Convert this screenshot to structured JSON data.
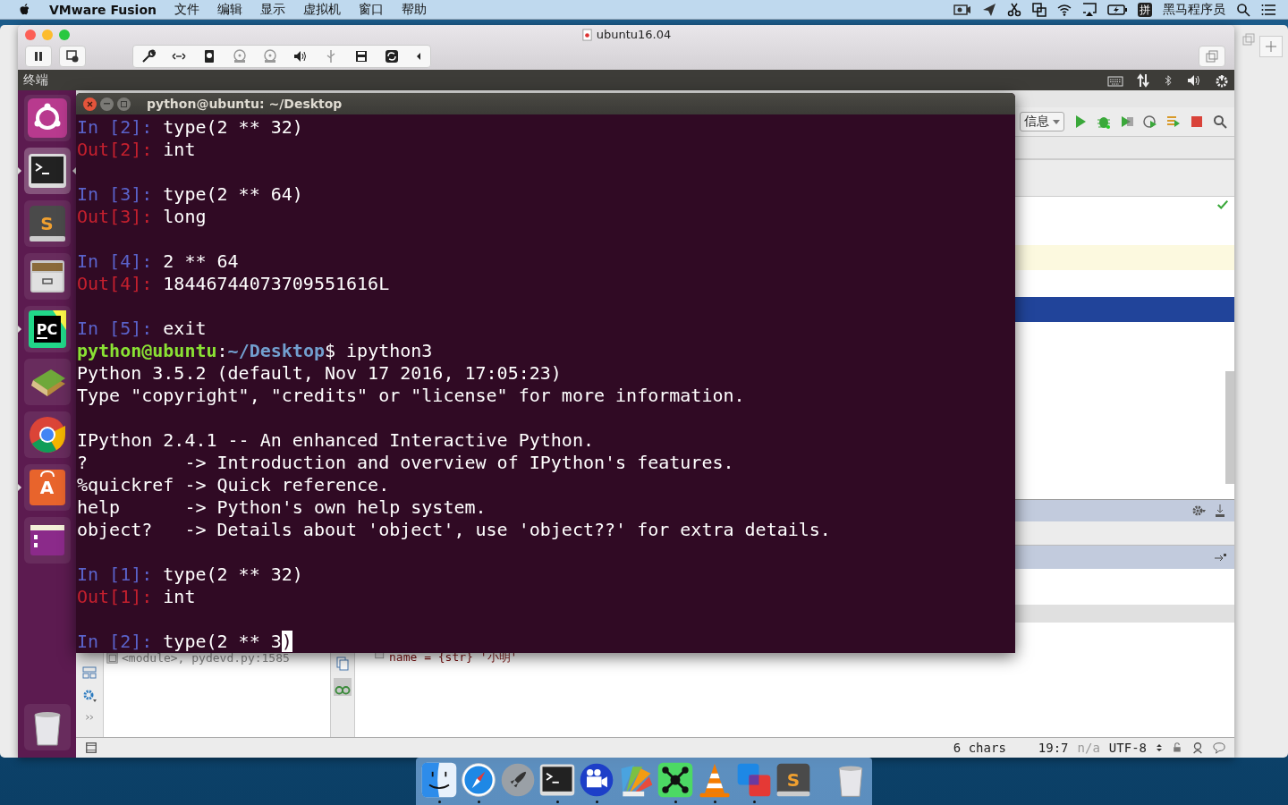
{
  "menubar": {
    "app_name": "VMware Fusion",
    "menus": [
      "文件",
      "编辑",
      "显示",
      "虚拟机",
      "窗口",
      "帮助"
    ],
    "input_method": "拼",
    "user_name": "黑马程序员"
  },
  "vm_window": {
    "title": "ubuntu16.04"
  },
  "ubuntu_panel": {
    "title": "终端"
  },
  "launcher": [
    {
      "kind": "ubuntu",
      "running": false,
      "focused": false
    },
    {
      "kind": "terminal",
      "running": true,
      "focused": true
    },
    {
      "kind": "sublime",
      "glyph": "S",
      "running": false,
      "focused": false
    },
    {
      "kind": "files",
      "running": false,
      "focused": false
    },
    {
      "kind": "pycharm",
      "glyph": "PC",
      "running": true,
      "focused": false
    },
    {
      "kind": "books",
      "running": false,
      "focused": false
    },
    {
      "kind": "chrome",
      "running": false,
      "focused": false
    },
    {
      "kind": "store",
      "glyph": "A",
      "running": true,
      "focused": false
    },
    {
      "kind": "window",
      "running": false,
      "focused": false
    },
    {
      "kind": "trash",
      "running": false,
      "focused": false
    }
  ],
  "terminal": {
    "title": "python@ubuntu: ~/Desktop",
    "lines": [
      {
        "kind": "text",
        "segments": [
          {
            "kind": "in",
            "text": "In [2]: "
          },
          {
            "kind": "plain",
            "text": "type(2 ** 32)"
          }
        ]
      },
      {
        "kind": "text",
        "segments": [
          {
            "kind": "out",
            "text": "Out[2]: "
          },
          {
            "kind": "plain",
            "text": "int"
          }
        ]
      },
      {
        "kind": "blank"
      },
      {
        "kind": "text",
        "segments": [
          {
            "kind": "in",
            "text": "In [3]: "
          },
          {
            "kind": "plain",
            "text": "type(2 ** 64)"
          }
        ]
      },
      {
        "kind": "text",
        "segments": [
          {
            "kind": "out",
            "text": "Out[3]: "
          },
          {
            "kind": "plain",
            "text": "long"
          }
        ]
      },
      {
        "kind": "blank"
      },
      {
        "kind": "text",
        "segments": [
          {
            "kind": "in",
            "text": "In [4]: "
          },
          {
            "kind": "plain",
            "text": "2 ** 64"
          }
        ]
      },
      {
        "kind": "text",
        "segments": [
          {
            "kind": "out",
            "text": "Out[4]: "
          },
          {
            "kind": "plain",
            "text": "18446744073709551616L"
          }
        ]
      },
      {
        "kind": "blank"
      },
      {
        "kind": "text",
        "segments": [
          {
            "kind": "in",
            "text": "In [5]: "
          },
          {
            "kind": "plain",
            "text": "exit"
          }
        ]
      },
      {
        "kind": "text",
        "segments": [
          {
            "kind": "user",
            "text": "python@ubuntu"
          },
          {
            "kind": "plain",
            "text": ":"
          },
          {
            "kind": "path",
            "text": "~/Desktop"
          },
          {
            "kind": "plain",
            "text": "$ ipython3"
          }
        ]
      },
      {
        "kind": "text",
        "segments": [
          {
            "kind": "plain",
            "text": "Python 3.5.2 (default, Nov 17 2016, 17:05:23)"
          }
        ]
      },
      {
        "kind": "text",
        "segments": [
          {
            "kind": "plain",
            "text": "Type \"copyright\", \"credits\" or \"license\" for more information."
          }
        ]
      },
      {
        "kind": "blank"
      },
      {
        "kind": "text",
        "segments": [
          {
            "kind": "plain",
            "text": "IPython 2.4.1 -- An enhanced Interactive Python."
          }
        ]
      },
      {
        "kind": "text",
        "segments": [
          {
            "kind": "plain",
            "text": "?         -> Introduction and overview of IPython's features."
          }
        ]
      },
      {
        "kind": "text",
        "segments": [
          {
            "kind": "plain",
            "text": "%quickref -> Quick reference."
          }
        ]
      },
      {
        "kind": "text",
        "segments": [
          {
            "kind": "plain",
            "text": "help      -> Python's own help system."
          }
        ]
      },
      {
        "kind": "text",
        "segments": [
          {
            "kind": "plain",
            "text": "object?   -> Details about 'object', use 'object??' for extra details."
          }
        ]
      },
      {
        "kind": "blank"
      },
      {
        "kind": "text",
        "segments": [
          {
            "kind": "in",
            "text": "In [1]: "
          },
          {
            "kind": "plain",
            "text": "type(2 ** 32)"
          }
        ]
      },
      {
        "kind": "text",
        "segments": [
          {
            "kind": "out",
            "text": "Out[1]: "
          },
          {
            "kind": "plain",
            "text": "int"
          }
        ]
      },
      {
        "kind": "blank"
      },
      {
        "kind": "text",
        "segments": [
          {
            "kind": "in",
            "text": "In [2]: "
          },
          {
            "kind": "plain",
            "text": "type(2 ** 3"
          },
          {
            "kind": "cursor",
            "text": ")"
          }
        ]
      }
    ]
  },
  "ide": {
    "config_dropdown": "信息",
    "frame": "<module>, pydevd.py:1585",
    "variable": "name = {str} '小明'",
    "status_bar": {
      "chars": "6 chars",
      "position": "19:7",
      "na": "n/a",
      "encoding": "UTF-8"
    }
  },
  "dock": [
    {
      "kind": "finder",
      "running": true
    },
    {
      "kind": "safari",
      "running": true
    },
    {
      "kind": "launchpad",
      "running": false
    },
    {
      "kind": "terminal",
      "running": true
    },
    {
      "kind": "camera",
      "running": true
    },
    {
      "kind": "fan",
      "running": false
    },
    {
      "kind": "network",
      "running": true
    },
    {
      "kind": "cone",
      "running": true
    },
    {
      "kind": "vmware",
      "running": true
    },
    {
      "kind": "sublime",
      "glyph": "S",
      "running": false
    },
    {
      "kind": "trash",
      "running": false
    }
  ]
}
